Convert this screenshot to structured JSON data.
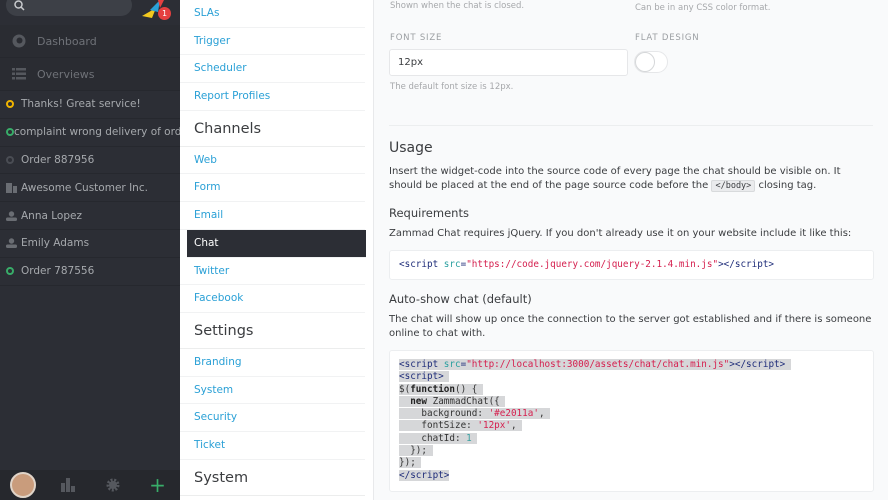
{
  "sidebar": {
    "badge_count": "1",
    "nav": [
      {
        "label": "Dashboard",
        "icon": "dashboard-icon"
      },
      {
        "label": "Overviews",
        "icon": "list-icon"
      }
    ],
    "tasks": [
      {
        "label": "Thanks! Great service!",
        "icon": "status-dot",
        "color": "#f0b400"
      },
      {
        "label": "complaint wrong delivery of ord...",
        "icon": "status-dot",
        "color": "#38ad69"
      },
      {
        "label": "Order 887956",
        "icon": "status-dot",
        "color": "#4a4d54"
      },
      {
        "label": "Awesome Customer Inc.",
        "icon": "organization-icon"
      },
      {
        "label": "Anna Lopez",
        "icon": "user-icon"
      },
      {
        "label": "Emily Adams",
        "icon": "user-icon"
      },
      {
        "label": "Order 787556",
        "icon": "status-dot",
        "color": "#38ad69"
      }
    ],
    "bottom_add": "+"
  },
  "settings_nav": {
    "items_top": [
      "SLAs",
      "Trigger",
      "Scheduler",
      "Report Profiles"
    ],
    "channels_heading": "Channels",
    "channels": [
      "Web",
      "Form",
      "Email",
      "Chat",
      "Twitter",
      "Facebook"
    ],
    "active": "Chat",
    "settings_heading": "Settings",
    "settings": [
      "Branding",
      "System",
      "Security",
      "Ticket"
    ],
    "system_heading": "System"
  },
  "main": {
    "hint_closed": "Shown when the chat is closed.",
    "hint_color": "Can be in any CSS color format.",
    "font_size_label": "FONT SIZE",
    "font_size_value": "12px",
    "font_size_hint": "The default font size is 12px.",
    "flat_design_label": "FLAT DESIGN",
    "flat_design_on": false,
    "usage_heading": "Usage",
    "usage_text_1": "Insert the widget-code into the source code of every page the chat should be visible on. It should be placed at the end of the page source code before the",
    "usage_code": "</body>",
    "usage_text_2": "closing tag.",
    "req_heading": "Requirements",
    "req_text": "Zammad Chat requires jQuery. If you don't already use it on your website include it like this:",
    "req_code": [
      [
        [
          "tag",
          "<script "
        ],
        [
          "attr",
          "src"
        ],
        [
          "tag",
          "="
        ],
        [
          "str",
          "\"https://code.jquery.com/jquery-2.1.4.min.js\""
        ],
        [
          "tag",
          "></script>"
        ]
      ]
    ],
    "auto_heading": "Auto-show chat (default)",
    "auto_text": "The chat will show up once the connection to the server got established and if there is someone online to chat with.",
    "auto_code": [
      [
        [
          "tag",
          "<script "
        ],
        [
          "attr",
          "src"
        ],
        [
          "tag",
          "="
        ],
        [
          "str",
          "\"http://localhost:3000/assets/chat/chat.min.js\""
        ],
        [
          "tag",
          "></script> "
        ]
      ],
      [
        [
          "tag",
          "<script> "
        ]
      ],
      [
        [
          "pl",
          "$("
        ],
        [
          "kw",
          "function"
        ],
        [
          "pl",
          "() { "
        ]
      ],
      [
        [
          "pl",
          "  "
        ],
        [
          "kw",
          "new"
        ],
        [
          "pl",
          " ZammadChat({ "
        ]
      ],
      [
        [
          "pl",
          "    background: "
        ],
        [
          "str",
          "'#e2011a'"
        ],
        [
          "pl",
          ", "
        ]
      ],
      [
        [
          "pl",
          "    fontSize: "
        ],
        [
          "str",
          "'12px'"
        ],
        [
          "pl",
          ", "
        ]
      ],
      [
        [
          "pl",
          "    chatId: "
        ],
        [
          "num",
          "1"
        ],
        [
          "pl",
          " "
        ]
      ],
      [
        [
          "pl",
          "  }); "
        ]
      ],
      [
        [
          "pl",
          "}); "
        ]
      ],
      [
        [
          "tag",
          "</script>"
        ]
      ]
    ]
  }
}
